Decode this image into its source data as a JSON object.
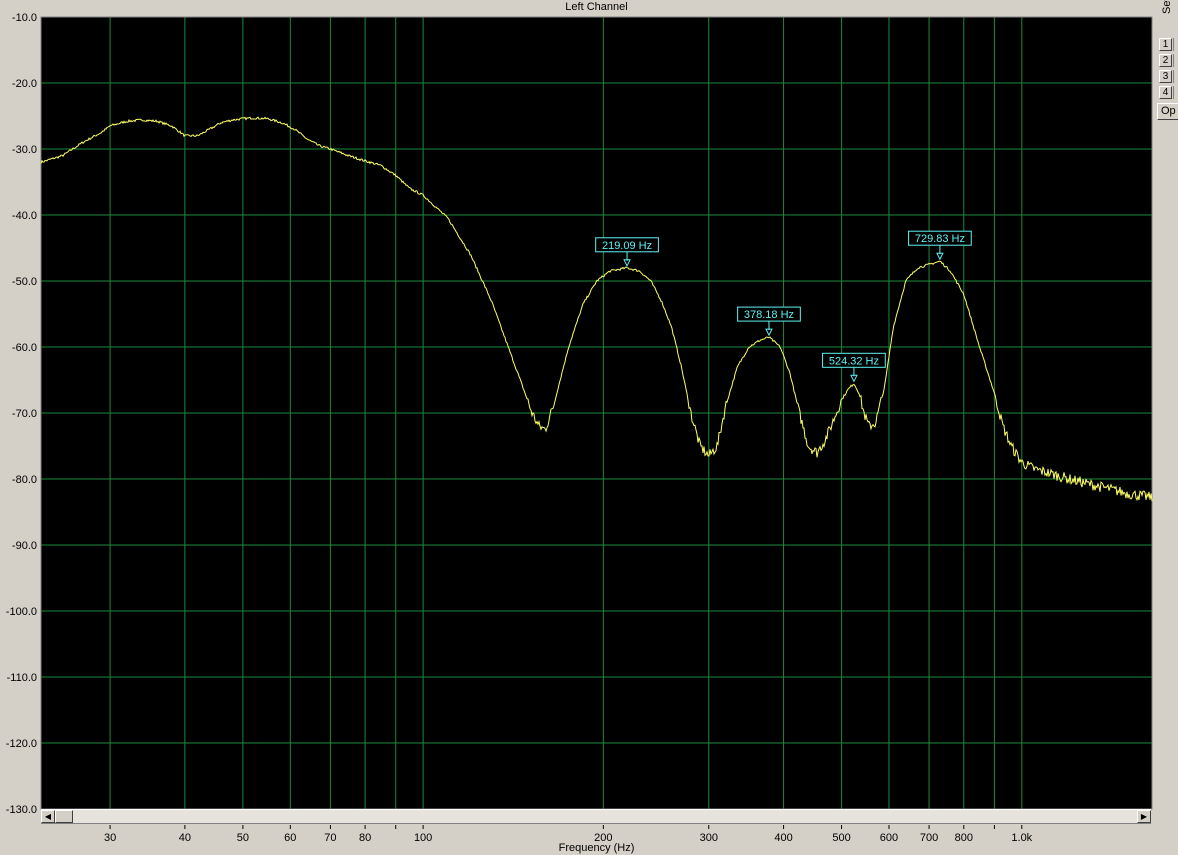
{
  "window": {
    "side_panel": {
      "set_label": "Set",
      "set_buttons": [
        "1",
        "2",
        "3",
        "4"
      ],
      "options_button": "Op"
    },
    "scrollbar": {
      "left_arrow": "◀",
      "right_arrow": "▶"
    }
  },
  "colors": {
    "plot_background": "#000000",
    "grid": "#1a8a3a",
    "trace": "#ffff66",
    "annotation": "#5ff2f2"
  },
  "chart_data": {
    "type": "line",
    "title": "Left Channel",
    "xlabel": "Frequency (Hz)",
    "ylabel": "",
    "x_scale": "log",
    "xlim": [
      23,
      1650
    ],
    "ylim": [
      -130,
      -10
    ],
    "grid": true,
    "yticks": [
      {
        "value": -10,
        "label": "-10.0"
      },
      {
        "value": -20,
        "label": "-20.0"
      },
      {
        "value": -30,
        "label": "-30.0"
      },
      {
        "value": -40,
        "label": "-40.0"
      },
      {
        "value": -50,
        "label": "-50.0"
      },
      {
        "value": -60,
        "label": "-60.0"
      },
      {
        "value": -70,
        "label": "-70.0"
      },
      {
        "value": -80,
        "label": "-80.0"
      },
      {
        "value": -90,
        "label": "-90.0"
      },
      {
        "value": -100,
        "label": "-100.0"
      },
      {
        "value": -110,
        "label": "-110.0"
      },
      {
        "value": -120,
        "label": "-120.0"
      },
      {
        "value": -130,
        "label": "-130.0"
      }
    ],
    "xticks": [
      {
        "value": 30,
        "label": "30"
      },
      {
        "value": 40,
        "label": "40"
      },
      {
        "value": 50,
        "label": "50"
      },
      {
        "value": 60,
        "label": "60"
      },
      {
        "value": 70,
        "label": "70"
      },
      {
        "value": 80,
        "label": "80"
      },
      {
        "value": 90,
        "label": ""
      },
      {
        "value": 100,
        "label": "100"
      },
      {
        "value": 200,
        "label": "200"
      },
      {
        "value": 300,
        "label": "300"
      },
      {
        "value": 400,
        "label": "400"
      },
      {
        "value": 500,
        "label": "500"
      },
      {
        "value": 600,
        "label": "600"
      },
      {
        "value": 700,
        "label": "700"
      },
      {
        "value": 800,
        "label": "800"
      },
      {
        "value": 900,
        "label": ""
      },
      {
        "value": 1000,
        "label": "1.0k"
      }
    ],
    "series": [
      {
        "x": [
          23,
          25,
          27,
          29,
          30,
          32,
          34,
          36,
          38,
          40,
          42,
          44,
          46,
          48,
          50,
          52,
          55,
          58,
          61,
          64,
          67,
          70,
          75,
          80,
          85,
          90,
          95,
          100,
          110,
          120,
          130,
          140,
          148,
          152,
          156,
          160,
          165,
          175,
          185,
          195,
          205,
          219,
          230,
          240,
          250,
          260,
          270,
          280,
          290,
          300,
          310,
          320,
          335,
          350,
          365,
          378,
          395,
          410,
          425,
          440,
          455,
          470,
          485,
          500,
          512,
          524,
          535,
          545,
          555,
          570,
          590,
          610,
          640,
          670,
          700,
          730,
          760,
          800,
          850,
          900,
          930,
          960,
          1000,
          1050,
          1100,
          1200,
          1300,
          1400,
          1500,
          1600,
          1650
        ],
        "y": [
          -32.0,
          -31.0,
          -29.0,
          -27.5,
          -26.5,
          -25.8,
          -25.6,
          -25.8,
          -26.5,
          -28.0,
          -28.0,
          -27.0,
          -26.0,
          -25.6,
          -25.4,
          -25.3,
          -25.4,
          -26.0,
          -27.0,
          -28.5,
          -29.5,
          -30.0,
          -31.0,
          -31.8,
          -32.5,
          -34.0,
          -36.0,
          -37.0,
          -40.5,
          -46.0,
          -53.0,
          -61.0,
          -67.0,
          -70.0,
          -72.0,
          -72.5,
          -69.0,
          -60.0,
          -53.5,
          -50.0,
          -48.5,
          -48.0,
          -48.5,
          -50.0,
          -53.0,
          -57.0,
          -63.0,
          -70.0,
          -75.0,
          -76.5,
          -75.0,
          -69.0,
          -63.0,
          -60.0,
          -59.0,
          -58.5,
          -60.0,
          -64.0,
          -70.0,
          -75.0,
          -76.0,
          -74.0,
          -71.0,
          -68.0,
          -66.5,
          -65.5,
          -67.0,
          -70.0,
          -72.0,
          -71.5,
          -66.0,
          -57.0,
          -50.0,
          -48.0,
          -47.5,
          -47.0,
          -48.5,
          -52.0,
          -60.0,
          -67.0,
          -72.0,
          -75.0,
          -77.5,
          -78.5,
          -79.0,
          -80.0,
          -80.8,
          -81.5,
          -82.2,
          -82.6,
          -82.8
        ]
      }
    ],
    "annotations": [
      {
        "x": 219.09,
        "y": -48.0,
        "label": "219.09 Hz"
      },
      {
        "x": 378.18,
        "y": -58.5,
        "label": "378.18 Hz"
      },
      {
        "x": 524.32,
        "y": -65.5,
        "label": "524.32 Hz"
      },
      {
        "x": 729.83,
        "y": -47.0,
        "label": "729.83 Hz"
      }
    ]
  }
}
